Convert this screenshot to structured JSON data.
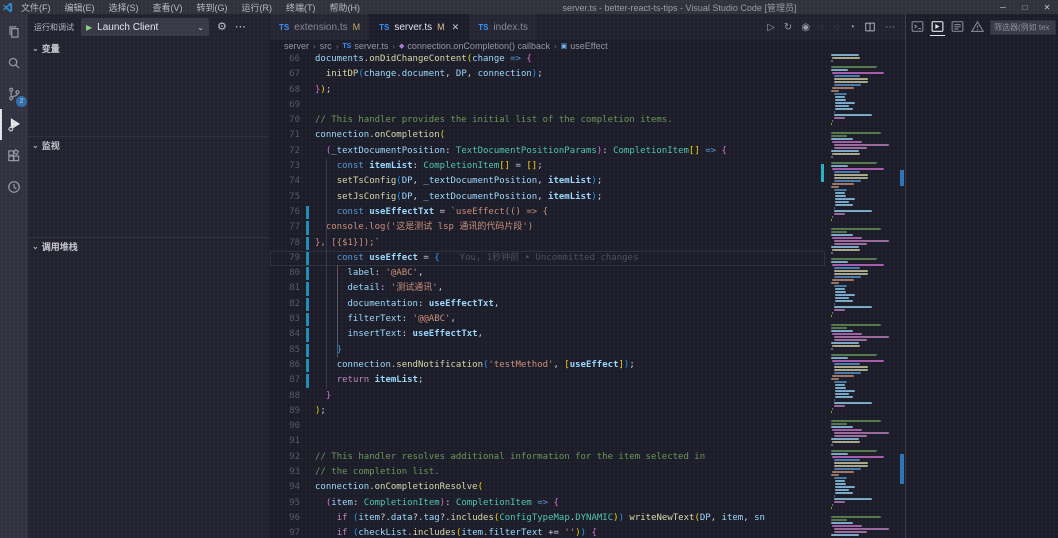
{
  "window": {
    "title": "server.ts - better-react-ts-tips - Visual Studio Code [管理员]",
    "menus": [
      "文件(F)",
      "编辑(E)",
      "选择(S)",
      "查看(V)",
      "转到(G)",
      "运行(R)",
      "终端(T)",
      "帮助(H)"
    ],
    "controls": [
      "minimize",
      "maximize",
      "close"
    ]
  },
  "activity_bar": {
    "items": [
      {
        "name": "explorer",
        "icon": "files-icon"
      },
      {
        "name": "search",
        "icon": "search-icon"
      },
      {
        "name": "source-control",
        "icon": "source-control-icon",
        "badge": "2"
      },
      {
        "name": "run-and-debug",
        "icon": "debug-icon",
        "active": true
      },
      {
        "name": "extensions",
        "icon": "extensions-icon"
      },
      {
        "name": "timeline",
        "icon": "clock-icon"
      }
    ]
  },
  "sidebar": {
    "title": "运行和调试",
    "launch_label": "Launch Client",
    "sections": [
      {
        "label": "变量"
      },
      {
        "label": "监视"
      },
      {
        "label": "调用堆栈"
      }
    ]
  },
  "tabs": [
    {
      "label": "extension.ts",
      "badge": "M",
      "active": false
    },
    {
      "label": "server.ts",
      "badge": "M",
      "active": true,
      "closable": true
    },
    {
      "label": "index.ts",
      "badge": "",
      "active": false
    }
  ],
  "editor_actions": [
    {
      "name": "run-icon"
    },
    {
      "name": "restart-icon"
    },
    {
      "name": "open-preview-icon"
    },
    {
      "name": "nav-back-icon",
      "dim": true
    },
    {
      "name": "nav-forward-icon",
      "dim": true
    },
    {
      "name": "run-timer-icon"
    },
    {
      "name": "split-editor-icon"
    },
    {
      "name": "more-actions-icon"
    }
  ],
  "breadcrumb": [
    {
      "label": "server"
    },
    {
      "label": "src"
    },
    {
      "label": "server.ts",
      "icon": "ts"
    },
    {
      "label": "connection.onCompletion() callback",
      "icon": "method"
    },
    {
      "label": "useEffect",
      "icon": "variable"
    }
  ],
  "panel": {
    "tabs": [
      {
        "name": "terminal-icon"
      },
      {
        "name": "debug-console-icon",
        "active": true
      },
      {
        "name": "output-icon"
      },
      {
        "name": "problems-icon"
      }
    ],
    "filter_placeholder": "筛选器(例如 tex"
  },
  "colors": {
    "accent_blue": "#3794ff",
    "modified_badge": "#e2c08d",
    "scm_badge": "#2f86d2",
    "debug_play_green": "#89d185",
    "modified_gutter": "#1f8fb4"
  },
  "editor": {
    "blame_line": 79,
    "blame": "You, 1秒钟前 • Uncommitted changes",
    "lines": [
      {
        "n": 66,
        "t": [
          [
            "documents",
            "v"
          ],
          [
            ".",
            "p"
          ],
          [
            "onDidChangeContent",
            "f"
          ],
          [
            "(",
            "b1"
          ],
          [
            "change",
            "v"
          ],
          [
            " ",
            "p"
          ],
          [
            "=>",
            "k"
          ],
          [
            " ",
            "p"
          ],
          [
            "{",
            "b2"
          ]
        ]
      },
      {
        "n": 67,
        "t": [
          [
            "  ",
            "p"
          ],
          [
            "initDP",
            "f"
          ],
          [
            "(",
            "b3"
          ],
          [
            "change",
            "v"
          ],
          [
            ".",
            "p"
          ],
          [
            "document",
            "v"
          ],
          [
            ", ",
            "p"
          ],
          [
            "DP",
            "v"
          ],
          [
            ", ",
            "p"
          ],
          [
            "connection",
            "v"
          ],
          [
            ")",
            "b3"
          ],
          [
            ";",
            "p"
          ]
        ]
      },
      {
        "n": 68,
        "t": [
          [
            "}",
            "b2"
          ],
          [
            ")",
            "b1"
          ],
          [
            ";",
            "p"
          ]
        ]
      },
      {
        "n": 69,
        "t": []
      },
      {
        "n": 70,
        "t": [
          [
            "// This handler provides the initial list of the completion items.",
            "c"
          ]
        ]
      },
      {
        "n": 71,
        "t": [
          [
            "connection",
            "v"
          ],
          [
            ".",
            "p"
          ],
          [
            "onCompletion",
            "f"
          ],
          [
            "(",
            "b1"
          ]
        ]
      },
      {
        "n": 72,
        "t": [
          [
            "  ",
            "p"
          ],
          [
            "(",
            "b2"
          ],
          [
            "_textDocumentPosition",
            "v"
          ],
          [
            ": ",
            "p"
          ],
          [
            "TextDocumentPositionParams",
            "t"
          ],
          [
            ")",
            "b2"
          ],
          [
            ": ",
            "p"
          ],
          [
            "CompletionItem",
            "t"
          ],
          [
            "[]",
            "b1"
          ],
          [
            " ",
            "p"
          ],
          [
            "=>",
            "k"
          ],
          [
            " ",
            "p"
          ],
          [
            "{",
            "b2"
          ]
        ]
      },
      {
        "n": 73,
        "t": [
          [
            "    ",
            "p"
          ],
          [
            "const",
            "k"
          ],
          [
            " ",
            "p"
          ],
          [
            "itemList",
            "vb"
          ],
          [
            ": ",
            "p"
          ],
          [
            "CompletionItem",
            "t"
          ],
          [
            "[]",
            "b1"
          ],
          [
            " = ",
            "p"
          ],
          [
            "[]",
            "b1"
          ],
          [
            ";",
            "p"
          ]
        ]
      },
      {
        "n": 74,
        "t": [
          [
            "    ",
            "p"
          ],
          [
            "setTsConfig",
            "f"
          ],
          [
            "(",
            "b3"
          ],
          [
            "DP",
            "v"
          ],
          [
            ", ",
            "p"
          ],
          [
            "_textDocumentPosition",
            "v"
          ],
          [
            ", ",
            "p"
          ],
          [
            "itemList",
            "vb"
          ],
          [
            ")",
            "b3"
          ],
          [
            ";",
            "p"
          ]
        ]
      },
      {
        "n": 75,
        "t": [
          [
            "    ",
            "p"
          ],
          [
            "setJsConfig",
            "f"
          ],
          [
            "(",
            "b3"
          ],
          [
            "DP",
            "v"
          ],
          [
            ", ",
            "p"
          ],
          [
            "_textDocumentPosition",
            "v"
          ],
          [
            ", ",
            "p"
          ],
          [
            "itemList",
            "vb"
          ],
          [
            ")",
            "b3"
          ],
          [
            ";",
            "p"
          ]
        ]
      },
      {
        "n": 76,
        "mod": true,
        "t": [
          [
            "    ",
            "p"
          ],
          [
            "const",
            "k"
          ],
          [
            " ",
            "p"
          ],
          [
            "useEffectTxt",
            "vb"
          ],
          [
            " = ",
            "p"
          ],
          [
            "`useEffect(() => {",
            "s"
          ]
        ]
      },
      {
        "n": 77,
        "mod": true,
        "t": [
          [
            "  console.log('这是测试 lsp 通讯的代码片段')",
            "s"
          ]
        ]
      },
      {
        "n": 78,
        "mod": true,
        "t": [
          [
            "}, [{$1}]);`",
            "s"
          ]
        ]
      },
      {
        "n": 79,
        "mod": true,
        "cur": true,
        "t": [
          [
            "    ",
            "p"
          ],
          [
            "const",
            "k"
          ],
          [
            " ",
            "p"
          ],
          [
            "useEffect",
            "vb"
          ],
          [
            " = ",
            "p"
          ],
          [
            "{",
            "b3"
          ]
        ]
      },
      {
        "n": 80,
        "mod": true,
        "t": [
          [
            "      ",
            "p"
          ],
          [
            "label",
            "v"
          ],
          [
            ": ",
            "p"
          ],
          [
            "'@ABC'",
            "s"
          ],
          [
            ",",
            "p"
          ]
        ]
      },
      {
        "n": 81,
        "mod": true,
        "t": [
          [
            "      ",
            "p"
          ],
          [
            "detail",
            "v"
          ],
          [
            ": ",
            "p"
          ],
          [
            "'测试通讯'",
            "s"
          ],
          [
            ",",
            "p"
          ]
        ]
      },
      {
        "n": 82,
        "mod": true,
        "t": [
          [
            "      ",
            "p"
          ],
          [
            "documentation",
            "v"
          ],
          [
            ": ",
            "p"
          ],
          [
            "useEffectTxt",
            "vb"
          ],
          [
            ",",
            "p"
          ]
        ]
      },
      {
        "n": 83,
        "mod": true,
        "t": [
          [
            "      ",
            "p"
          ],
          [
            "filterText",
            "v"
          ],
          [
            ": ",
            "p"
          ],
          [
            "'@@ABC'",
            "s"
          ],
          [
            ",",
            "p"
          ]
        ]
      },
      {
        "n": 84,
        "mod": true,
        "t": [
          [
            "      ",
            "p"
          ],
          [
            "insertText",
            "v"
          ],
          [
            ": ",
            "p"
          ],
          [
            "useEffectTxt",
            "vb"
          ],
          [
            ",",
            "p"
          ]
        ]
      },
      {
        "n": 85,
        "mod": true,
        "t": [
          [
            "    ",
            "p"
          ],
          [
            "}",
            "b3"
          ]
        ]
      },
      {
        "n": 86,
        "mod": true,
        "t": [
          [
            "    ",
            "p"
          ],
          [
            "connection",
            "v"
          ],
          [
            ".",
            "p"
          ],
          [
            "sendNotification",
            "f"
          ],
          [
            "(",
            "b3"
          ],
          [
            "'testMethod'",
            "s"
          ],
          [
            ", ",
            "p"
          ],
          [
            "[",
            "b1"
          ],
          [
            "useEffect",
            "vb"
          ],
          [
            "]",
            "b1"
          ],
          [
            ")",
            "b3"
          ],
          [
            ";",
            "p"
          ]
        ]
      },
      {
        "n": 87,
        "mod": true,
        "t": [
          [
            "    ",
            "p"
          ],
          [
            "return",
            "kc"
          ],
          [
            " ",
            "p"
          ],
          [
            "itemList",
            "vb"
          ],
          [
            ";",
            "p"
          ]
        ]
      },
      {
        "n": 88,
        "t": [
          [
            "  ",
            "p"
          ],
          [
            "}",
            "b2"
          ]
        ]
      },
      {
        "n": 89,
        "t": [
          [
            ")",
            "b1"
          ],
          [
            ";",
            "p"
          ]
        ]
      },
      {
        "n": 90,
        "t": []
      },
      {
        "n": 91,
        "t": []
      },
      {
        "n": 92,
        "t": [
          [
            "// This handler resolves additional information for the item selected in",
            "c"
          ]
        ]
      },
      {
        "n": 93,
        "t": [
          [
            "// the completion list.",
            "c"
          ]
        ]
      },
      {
        "n": 94,
        "t": [
          [
            "connection",
            "v"
          ],
          [
            ".",
            "p"
          ],
          [
            "onCompletionResolve",
            "f"
          ],
          [
            "(",
            "b1"
          ]
        ]
      },
      {
        "n": 95,
        "t": [
          [
            "  ",
            "p"
          ],
          [
            "(",
            "b2"
          ],
          [
            "item",
            "v"
          ],
          [
            ": ",
            "p"
          ],
          [
            "CompletionItem",
            "t"
          ],
          [
            ")",
            "b2"
          ],
          [
            ": ",
            "p"
          ],
          [
            "CompletionItem",
            "t"
          ],
          [
            " ",
            "p"
          ],
          [
            "=>",
            "k"
          ],
          [
            " ",
            "p"
          ],
          [
            "{",
            "b2"
          ]
        ]
      },
      {
        "n": 96,
        "t": [
          [
            "    ",
            "p"
          ],
          [
            "if",
            "kc"
          ],
          [
            " ",
            "p"
          ],
          [
            "(",
            "b3"
          ],
          [
            "item",
            "v"
          ],
          [
            "?.",
            "p"
          ],
          [
            "data",
            "v"
          ],
          [
            "?.",
            "p"
          ],
          [
            "tag",
            "v"
          ],
          [
            "?.",
            "p"
          ],
          [
            "includes",
            "f"
          ],
          [
            "(",
            "b1"
          ],
          [
            "ConfigTypeMap",
            "t"
          ],
          [
            ".",
            "p"
          ],
          [
            "DYNAMIC",
            "t"
          ],
          [
            ")",
            "b1"
          ],
          [
            ")",
            "b3"
          ],
          [
            " ",
            "p"
          ],
          [
            "writeNewText",
            "f"
          ],
          [
            "(",
            "b1"
          ],
          [
            "DP",
            "v"
          ],
          [
            ", ",
            "p"
          ],
          [
            "item",
            "v"
          ],
          [
            ", ",
            "p"
          ],
          [
            "sn",
            "v"
          ]
        ]
      },
      {
        "n": 97,
        "t": [
          [
            "    ",
            "p"
          ],
          [
            "if",
            "kc"
          ],
          [
            " ",
            "p"
          ],
          [
            "(",
            "b3"
          ],
          [
            "checkList",
            "v"
          ],
          [
            ".",
            "p"
          ],
          [
            "includes",
            "f"
          ],
          [
            "(",
            "b1"
          ],
          [
            "item",
            "v"
          ],
          [
            ".",
            "p"
          ],
          [
            "filterText",
            "v"
          ],
          [
            " += ",
            "p"
          ],
          [
            "''",
            "s"
          ],
          [
            ")",
            "b1"
          ],
          [
            ")",
            "b3"
          ],
          [
            " ",
            "p"
          ],
          [
            "{",
            "b2"
          ]
        ]
      }
    ]
  }
}
